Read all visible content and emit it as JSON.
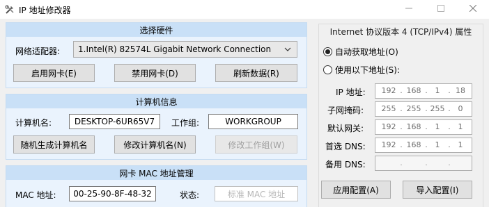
{
  "window": {
    "title": "IP 地址修改器"
  },
  "hardware": {
    "header": "选择硬件",
    "adapter_label": "网络适配器:",
    "adapter_value": "1.Intel(R) 82574L Gigabit Network Connection",
    "enable_label": "启用网卡(E)",
    "disable_label": "禁用网卡(D)",
    "refresh_label": "刷新数据(R)"
  },
  "computer": {
    "header": "计算机信息",
    "name_label": "计算机名:",
    "name_value": "DESKTOP-6UR65V7",
    "workgroup_label": "工作组:",
    "workgroup_value": "WORKGROUP",
    "random_name_label": "随机生成计算机名",
    "rename_label": "修改计算机名(N)",
    "workgroup_btn_label": "修改工作组(W)"
  },
  "mac": {
    "header": "网卡 MAC 地址管理",
    "mac_label": "MAC 地址:",
    "mac_value": "00-25-90-8F-48-32",
    "status_label": "状态:",
    "status_value": "标准 MAC 地址"
  },
  "ipv4": {
    "header": "Internet 协议版本 4 (TCP/IPv4) 属性",
    "auto_label": "自动获取地址(O)",
    "manual_label": "使用以下地址(S):",
    "auto_selected": true,
    "ip_label": "IP 地址:",
    "ip": [
      "192",
      "168",
      "1",
      "18"
    ],
    "mask_label": "子网掩码:",
    "mask": [
      "255",
      "255",
      "255",
      "0"
    ],
    "gateway_label": "默认网关:",
    "gateway": [
      "192",
      "168",
      "1",
      "1"
    ],
    "dns1_label": "首选 DNS:",
    "dns1": [
      "192",
      "168",
      "1",
      "1"
    ],
    "dns2_label": "备用 DNS:",
    "dns2": [
      "",
      "",
      "",
      ""
    ],
    "apply_label": "应用配置(A)",
    "import_label": "导入配置(I)"
  }
}
